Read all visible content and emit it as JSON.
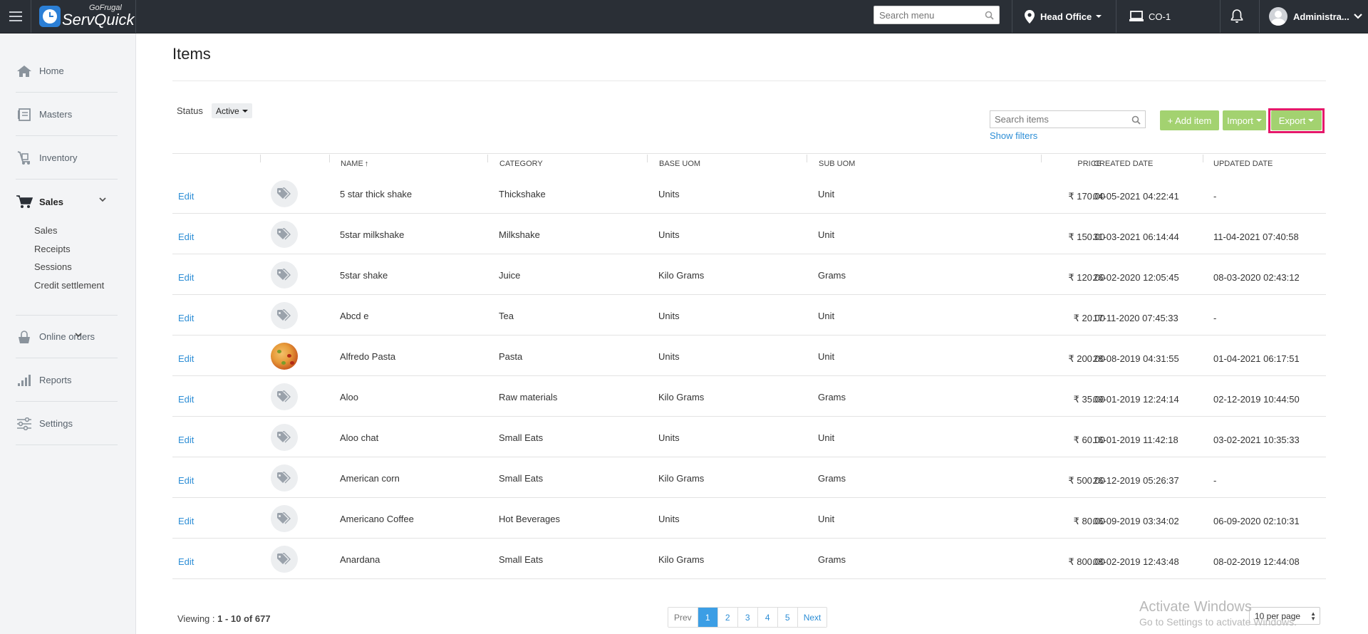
{
  "topbar": {
    "logo_small": "GoFrugal",
    "logo_big": "ServQuick",
    "search_placeholder": "Search menu",
    "location": "Head Office",
    "counter": "CO-1",
    "user": "Administra..."
  },
  "sidebar": {
    "items": [
      {
        "label": "Home",
        "icon": "home-icon"
      },
      {
        "label": "Masters",
        "icon": "masters-icon"
      },
      {
        "label": "Inventory",
        "icon": "inventory-icon"
      },
      {
        "label": "Sales",
        "icon": "cart-icon"
      },
      {
        "label": "Online orders",
        "icon": "online-orders-icon"
      },
      {
        "label": "Reports",
        "icon": "reports-icon"
      },
      {
        "label": "Settings",
        "icon": "settings-icon"
      }
    ],
    "sales_sub": [
      "Sales",
      "Receipts",
      "Sessions",
      "Credit settlement"
    ]
  },
  "page": {
    "title": "Items",
    "status_label": "Status",
    "status_value": "Active",
    "search_placeholder": "Search items",
    "show_filters": "Show filters",
    "add_item": "+ Add item",
    "import": "Import",
    "export": "Export"
  },
  "table": {
    "headers": {
      "name": "NAME",
      "sort_arrow": "↑",
      "category": "CATEGORY",
      "base_uom": "BASE UOM",
      "sub_uom": "SUB UOM",
      "price": "PRICE",
      "created": "CREATED DATE",
      "updated": "UPDATED DATE"
    },
    "edit_label": "Edit",
    "rows": [
      {
        "name": "5 star thick shake",
        "category": "Thickshake",
        "base_uom": "Units",
        "sub_uom": "Unit",
        "price": "₹ 170.00",
        "created": "04-05-2021 04:22:41",
        "updated": "-",
        "image": "tag"
      },
      {
        "name": "5star milkshake",
        "category": "Milkshake",
        "base_uom": "Units",
        "sub_uom": "Unit",
        "price": "₹ 150.00",
        "created": "31-03-2021 06:14:44",
        "updated": "11-04-2021 07:40:58",
        "image": "tag"
      },
      {
        "name": "5star shake",
        "category": "Juice",
        "base_uom": "Kilo Grams",
        "sub_uom": "Grams",
        "price": "₹ 120.00",
        "created": "26-02-2020 12:05:45",
        "updated": "08-03-2020 02:43:12",
        "image": "tag"
      },
      {
        "name": "Abcd e",
        "category": "Tea",
        "base_uom": "Units",
        "sub_uom": "Unit",
        "price": "₹ 20.00",
        "created": "17-11-2020 07:45:33",
        "updated": "-",
        "image": "tag"
      },
      {
        "name": "Alfredo Pasta",
        "category": "Pasta",
        "base_uom": "Units",
        "sub_uom": "Unit",
        "price": "₹ 200.00",
        "created": "28-08-2019 04:31:55",
        "updated": "01-04-2021 06:17:51",
        "image": "photo"
      },
      {
        "name": "Aloo",
        "category": "Raw materials",
        "base_uom": "Kilo Grams",
        "sub_uom": "Grams",
        "price": "₹ 35.00",
        "created": "09-01-2019 12:24:14",
        "updated": "02-12-2019 10:44:50",
        "image": "tag"
      },
      {
        "name": "Aloo chat",
        "category": "Small Eats",
        "base_uom": "Units",
        "sub_uom": "Unit",
        "price": "₹ 60.00",
        "created": "16-01-2019 11:42:18",
        "updated": "03-02-2021 10:35:33",
        "image": "tag"
      },
      {
        "name": "American corn",
        "category": "Small Eats",
        "base_uom": "Kilo Grams",
        "sub_uom": "Grams",
        "price": "₹ 500.00",
        "created": "26-12-2019 05:26:37",
        "updated": "-",
        "image": "tag"
      },
      {
        "name": "Americano Coffee",
        "category": "Hot Beverages",
        "base_uom": "Units",
        "sub_uom": "Unit",
        "price": "₹ 80.00",
        "created": "06-09-2019 03:34:02",
        "updated": "06-09-2020 02:10:31",
        "image": "tag"
      },
      {
        "name": "Anardana",
        "category": "Small Eats",
        "base_uom": "Kilo Grams",
        "sub_uom": "Grams",
        "price": "₹ 800.00",
        "created": "08-02-2019 12:43:48",
        "updated": "08-02-2019 12:44:08",
        "image": "tag"
      }
    ]
  },
  "footer": {
    "viewing_label": "Viewing : ",
    "viewing_range": "1 - 10 of 677",
    "pages": [
      "Prev",
      "1",
      "2",
      "3",
      "4",
      "5",
      "Next"
    ],
    "active_page": "1",
    "per_page": "10 per page"
  },
  "watermark": {
    "line1": "Activate Windows",
    "line2": "Go to Settings to activate Windows."
  },
  "colors": {
    "topbar": "#2a2f36",
    "accent_green": "#a3d270",
    "link_blue": "#2d8ed6",
    "highlight": "#e5186a"
  }
}
